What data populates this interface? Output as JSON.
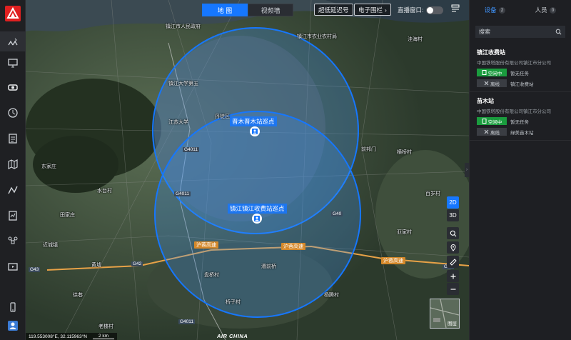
{
  "nav": {
    "items": [
      "grid-icon",
      "monitor-icon",
      "camera-icon",
      "history-icon",
      "list-icon",
      "map-icon",
      "route-icon",
      "report-icon",
      "drone-icon",
      "media-icon",
      "phone-icon",
      "user-icon"
    ]
  },
  "map": {
    "toggle": {
      "map_label": "地 图",
      "video_label": "视频墙"
    },
    "actions": {
      "low_latency": "超低延迟号",
      "fence": "电子围栏",
      "live_window": "直播窗口:"
    },
    "circle_top_label": "晋木晋木站巡点",
    "circle_bottom_label": "镇江镇江收费站巡点",
    "places": [
      "镇江市人民政府",
      "镇江市农业农村局",
      "镇江大学第五",
      "江苏大学",
      "丹徒区",
      "东家庄",
      "水台村",
      "田家庄",
      "近城镇",
      "黄墟",
      "徐巷",
      "老楼村",
      "盘桥村",
      "前邦门",
      "横桥村",
      "杨腾村",
      "漕前桥",
      "桥子村",
      "洼海村",
      "百岁村",
      "亚家村"
    ],
    "roads": [
      "G4011",
      "G4011",
      "G4011",
      "G40",
      "G43",
      "G42",
      "G42"
    ],
    "highways": [
      "沪蓉高速",
      "沪蓉高速",
      "沪蓉高速"
    ],
    "controls": {
      "2d": "2D",
      "3d": "3D",
      "layer": "图层"
    },
    "scale": "119.553008°E, 32.115963°N",
    "scale_km": "2 km",
    "brand": "AIR CHINA"
  },
  "panel": {
    "tabs": [
      {
        "label": "设备",
        "count": "2"
      },
      {
        "label": "人员",
        "count": "0"
      }
    ],
    "search_placeholder": "搜索",
    "stations": [
      {
        "name": "镇江收费站",
        "org": "中国铁塔股份有限公司镇江市分公司",
        "devices": [
          {
            "status": "空闲中",
            "text": "暂无任务"
          },
          {
            "status": "离线",
            "text": "镇江收费站"
          }
        ]
      },
      {
        "name": "苗木站",
        "org": "中国铁塔股份有限公司镇江市分公司",
        "devices": [
          {
            "status": "空闲中",
            "text": "暂无任务"
          },
          {
            "status": "离线",
            "text": "绿美苗木站"
          }
        ]
      }
    ]
  },
  "colors": {
    "accent": "#1677ff",
    "green": "#1a9c3e",
    "logo": "#e02020"
  }
}
